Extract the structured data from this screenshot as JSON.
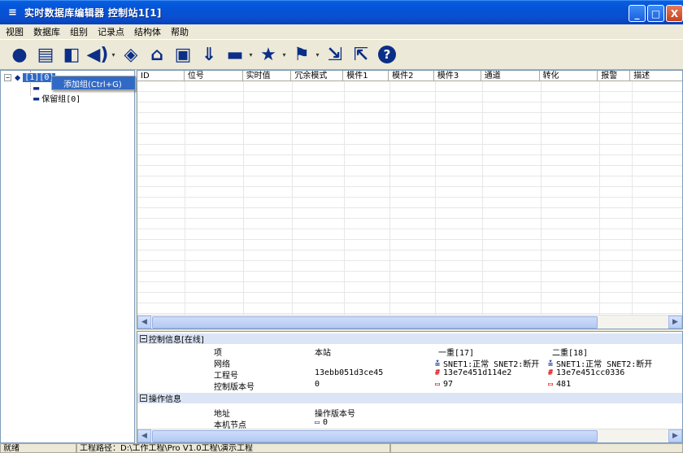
{
  "window": {
    "title": "实时数据库编辑器 控制站1[1]",
    "app_icon": "≡",
    "buttons": {
      "minimize": "_",
      "maximize": "□",
      "close": "X"
    }
  },
  "menu": [
    "视图",
    "数据库",
    "组别",
    "记录点",
    "结构体",
    "帮助"
  ],
  "toolbar": {
    "icons": [
      "user-icon",
      "print-icon",
      "import-icon",
      "speaker-icon",
      "tag-icon",
      "alarm-icon",
      "trend-icon",
      "download-icon",
      "comment-icon",
      "star-icon",
      "flag-icon",
      "export-icon",
      "import-x-icon",
      "help-icon"
    ],
    "help_label": "?"
  },
  "tree": {
    "root_label": "[1][0]",
    "child2_label": "保留组[0]",
    "context_menu_item": "添加组(Ctrl+G)"
  },
  "grid": {
    "columns": [
      "ID",
      "位号",
      "实时值",
      "冗余模式",
      "模件1",
      "模件2",
      "模件3",
      "通道",
      "转化",
      "报警",
      "描述"
    ]
  },
  "info": {
    "section1_title": "控制信息[在线]",
    "section2_title": "操作信息",
    "headers": {
      "item": "项",
      "local": "本站",
      "primary": "一重[17]",
      "secondary": "二重[18]"
    },
    "rows": [
      {
        "label": "网络",
        "local": "",
        "primary": "SNET1:正常 SNET2:断开",
        "secondary": "SNET1:正常 SNET2:断开"
      },
      {
        "label": "工程号",
        "local": "13ebb051d3ce45",
        "primary": "13e7e451d114e2",
        "secondary": "13e7e451cc0336"
      },
      {
        "label": "控制版本号",
        "local": "0",
        "primary": "97",
        "secondary": "481"
      }
    ],
    "op_headers": {
      "address": "地址",
      "op_version": "操作版本号"
    },
    "op_rows": [
      {
        "label": "本机节点",
        "value": "0"
      }
    ]
  },
  "statusbar": {
    "ready": "就绪",
    "path": "工程路径：D:\\工作工程\\Pro V1.0工程\\演示工程"
  }
}
